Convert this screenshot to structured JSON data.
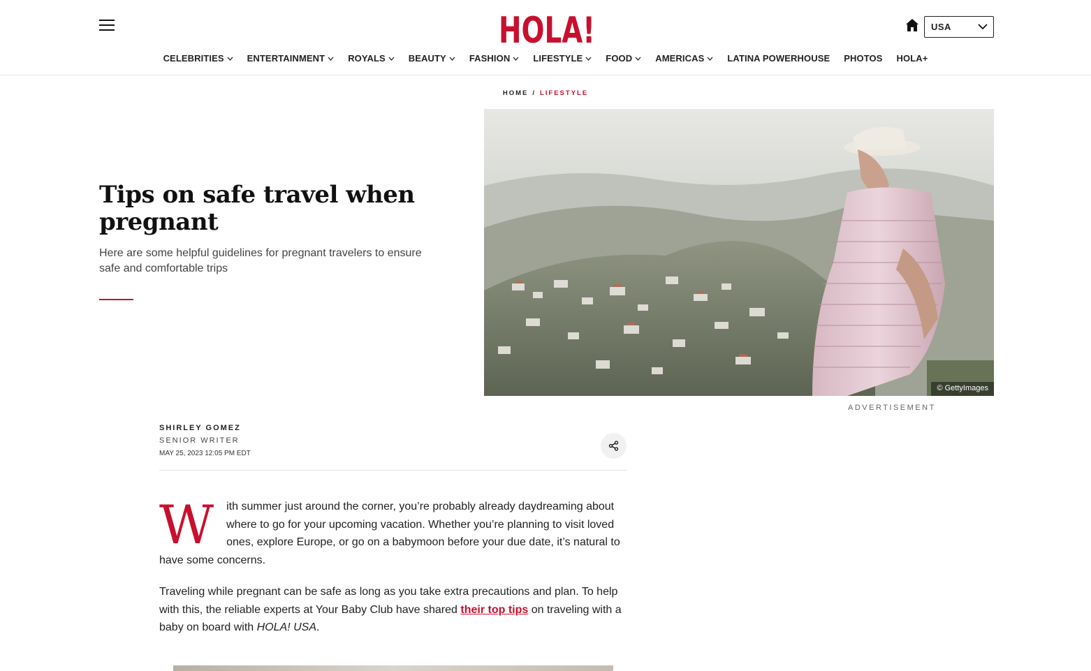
{
  "header": {
    "logo_text": "HOLA!",
    "region_label": "USA",
    "brand_color": "#c8102e"
  },
  "nav": {
    "items": [
      {
        "label": "CELEBRITIES",
        "dropdown": true
      },
      {
        "label": "ENTERTAINMENT",
        "dropdown": true
      },
      {
        "label": "ROYALS",
        "dropdown": true
      },
      {
        "label": "BEAUTY",
        "dropdown": true
      },
      {
        "label": "FASHION",
        "dropdown": true
      },
      {
        "label": "LIFESTYLE",
        "dropdown": true
      },
      {
        "label": "FOOD",
        "dropdown": true
      },
      {
        "label": "AMERICAS",
        "dropdown": true
      },
      {
        "label": "LATINA POWERHOUSE",
        "dropdown": false
      },
      {
        "label": "PHOTOS",
        "dropdown": false
      },
      {
        "label": "HOLA+",
        "dropdown": false
      }
    ]
  },
  "breadcrumb": {
    "home": "HOME",
    "separator": "/",
    "current": "LIFESTYLE"
  },
  "article": {
    "title": "Tips on safe travel when pregnant",
    "subtitle": "Here are some helpful guidelines for pregnant travelers to ensure safe and comfortable trips",
    "image_credit": "© GettyImages",
    "advertisement_label": "ADVERTISEMENT",
    "author": {
      "name": "SHIRLEY GOMEZ",
      "role": "SENIOR WRITER",
      "date": "MAY 25, 2023 12:05 PM EDT"
    },
    "paragraph1": {
      "dropcap": "W",
      "text": "ith summer just around the corner, you’re probably already daydreaming about where to go for your upcoming vacation. Whether you’re planning to visit loved ones, explore Europe, or go on a babymoon before your due date, it’s natural to have some concerns."
    },
    "paragraph2": {
      "before_link": "Traveling while pregnant can be safe as long as you take extra precautions and plan. To help with this, the reliable experts at Your Baby Club have shared ",
      "link_text": "their top tips",
      "after_link": " on traveling with a baby on board with ",
      "italic": "HOLA! USA",
      "end": "."
    }
  },
  "icons": {
    "menu": "hamburger-menu-icon",
    "home": "home-icon",
    "region_chevron": "chevron-down-icon",
    "nav_chevron": "chevron-down-icon",
    "share": "share-icon"
  }
}
